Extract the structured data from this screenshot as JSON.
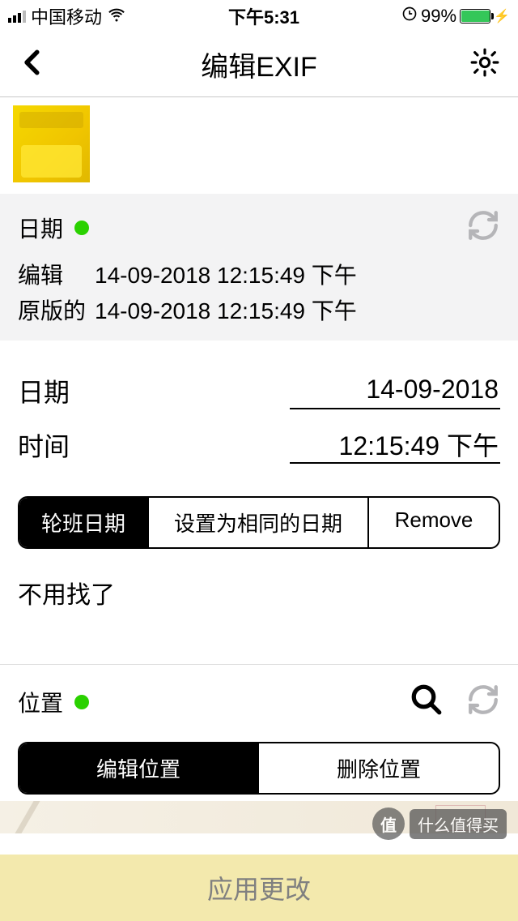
{
  "status": {
    "carrier": "中国移动",
    "time": "下午5:31",
    "battery_pct": "99%"
  },
  "nav": {
    "title": "编辑EXIF"
  },
  "date_section": {
    "label": "日期",
    "edited_label": "编辑",
    "edited_value": "14-09-2018 12:15:49 下午",
    "original_label": "原版的",
    "original_value": "14-09-2018 12:15:49 下午",
    "date_field_label": "日期",
    "date_value": "14-09-2018",
    "time_field_label": "时间",
    "time_value": "12:15:49 下午",
    "seg_shift": "轮班日期",
    "seg_same": "设置为相同的日期",
    "seg_remove": "Remove",
    "no_find": "不用找了"
  },
  "location_section": {
    "label": "位置",
    "seg_edit": "编辑位置",
    "seg_delete": "删除位置"
  },
  "apply": {
    "label": "应用更改"
  },
  "watermark": {
    "badge": "值",
    "text": "什么值得买"
  }
}
